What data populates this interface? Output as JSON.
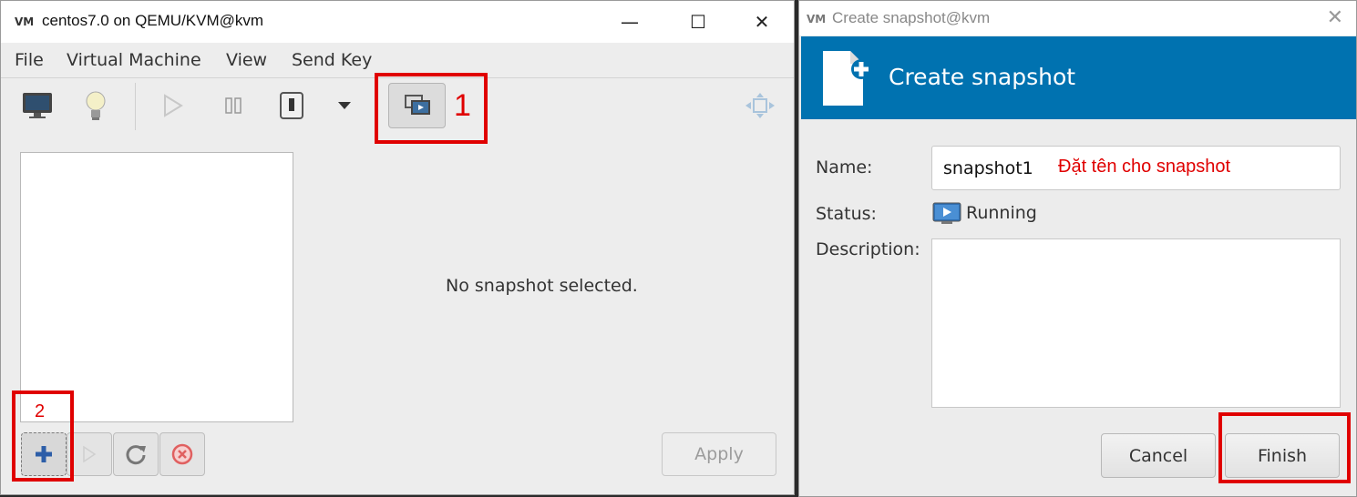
{
  "main_window": {
    "title": "centos7.0 on QEMU/KVM@kvm",
    "controls": {
      "minimize": "—",
      "maximize": "☐",
      "close": "✕"
    },
    "menu": [
      "File",
      "Virtual Machine",
      "View",
      "Send Key"
    ],
    "toolbar_icons": [
      "console-icon",
      "details-lightbulb-icon",
      "run-icon",
      "pause-icon",
      "shutdown-icon",
      "dropdown-icon",
      "snapshots-icon",
      "fullscreen-icon"
    ],
    "placeholder": "No snapshot selected.",
    "apply_label": "Apply",
    "annotations": {
      "one": "1",
      "two": "2"
    }
  },
  "dialog": {
    "window_title": "Create snapshot@kvm",
    "close": "✕",
    "banner_title": "Create snapshot",
    "name_label": "Name:",
    "name_value": "snapshot1",
    "name_note": "Đặt tên cho snapshot",
    "status_label": "Status:",
    "status_value": "Running",
    "description_label": "Description:",
    "description_value": "",
    "cancel_label": "Cancel",
    "finish_label": "Finish"
  },
  "colors": {
    "banner": "#0072b0",
    "highlight": "#e00000"
  }
}
